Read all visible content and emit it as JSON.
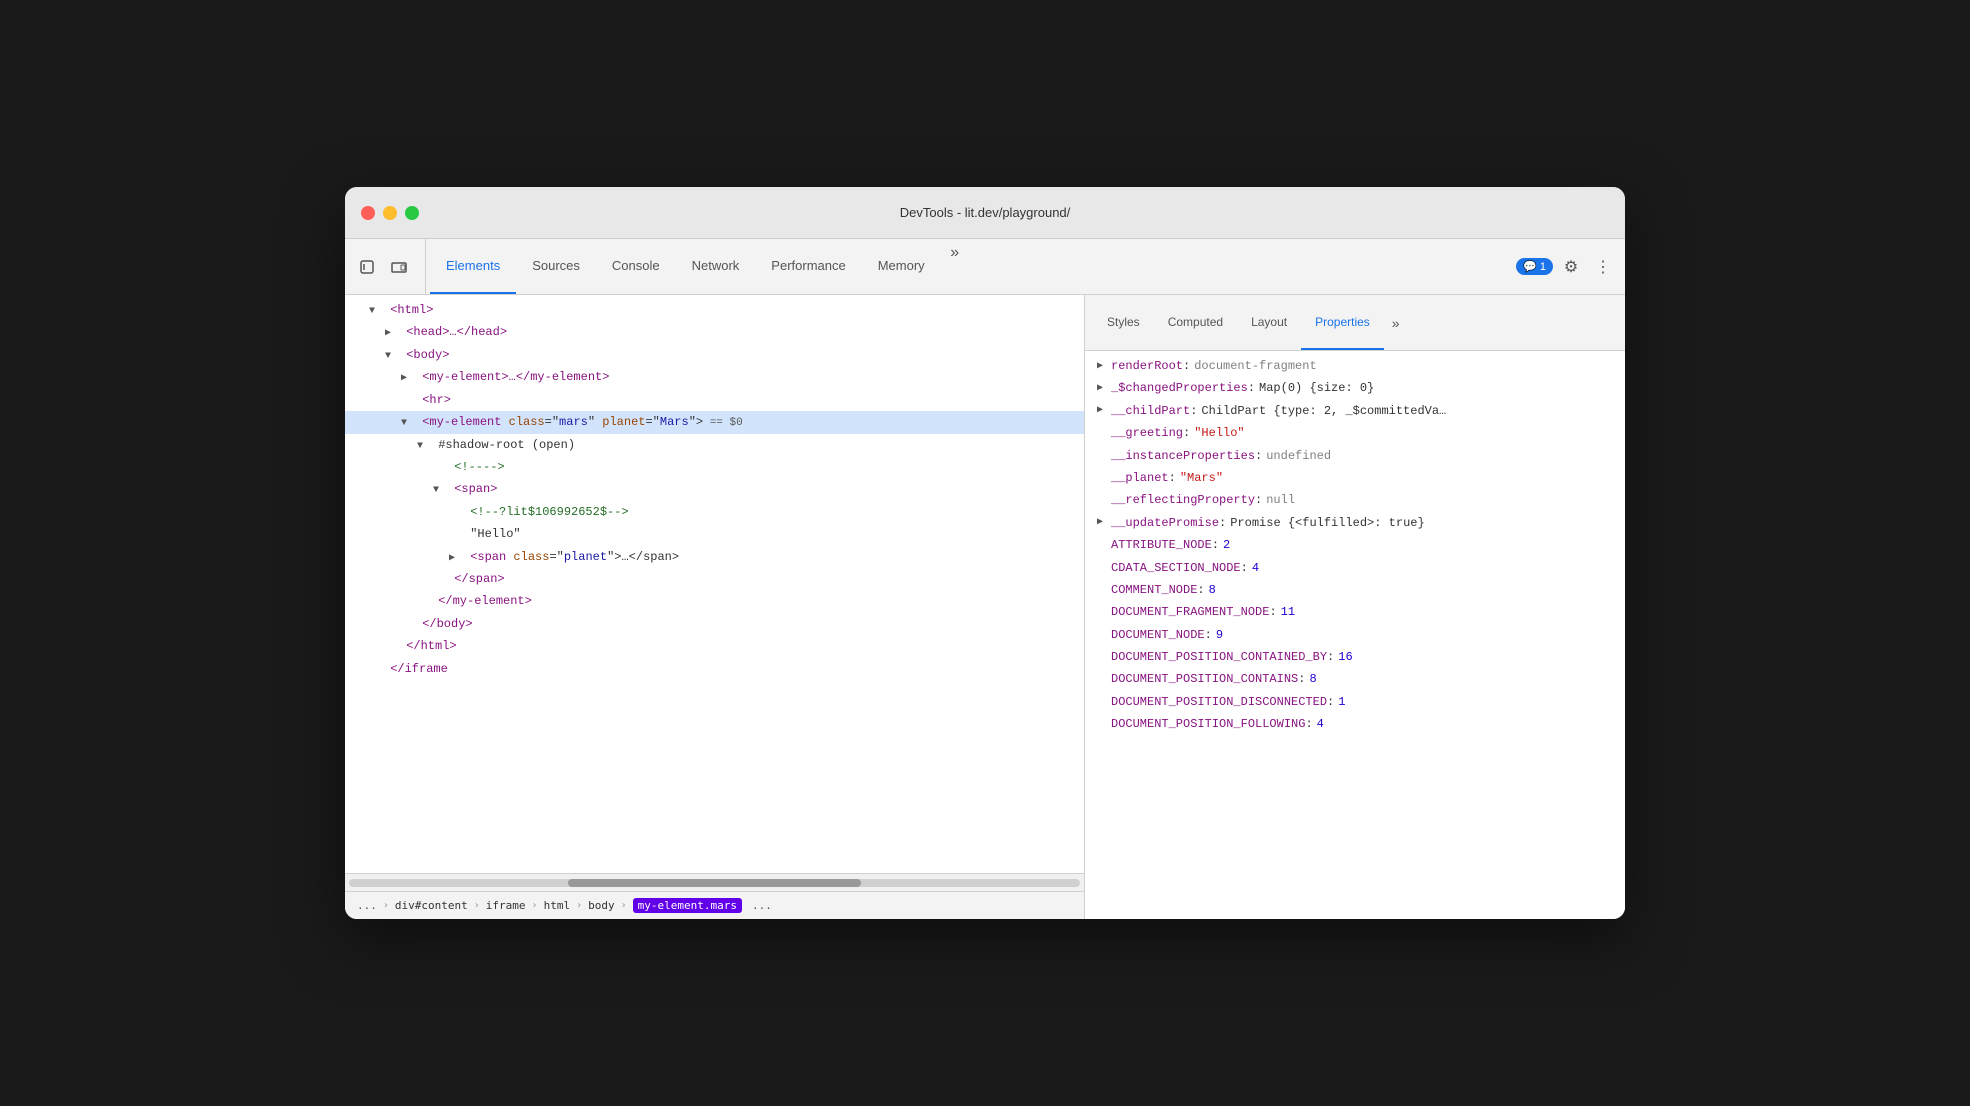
{
  "window": {
    "title": "DevTools - lit.dev/playground/"
  },
  "tabs": {
    "main": [
      {
        "label": "Elements",
        "active": true
      },
      {
        "label": "Sources"
      },
      {
        "label": "Console"
      },
      {
        "label": "Network"
      },
      {
        "label": "Performance"
      },
      {
        "label": "Memory"
      }
    ],
    "panel": [
      {
        "label": "Styles"
      },
      {
        "label": "Computed"
      },
      {
        "label": "Layout"
      },
      {
        "label": "Properties",
        "active": true
      }
    ],
    "chat_badge": "💬 1"
  },
  "dom": {
    "lines": [
      {
        "indent": 1,
        "html": "▼ <html>",
        "type": "tag"
      },
      {
        "indent": 2,
        "html": "▶ <head>…</head>",
        "type": "tag"
      },
      {
        "indent": 2,
        "html": "▼ <body>",
        "type": "tag"
      },
      {
        "indent": 3,
        "html": "▶ <my-element>…</my-element>",
        "type": "tag"
      },
      {
        "indent": 4,
        "html": "<hr>",
        "type": "tag"
      },
      {
        "indent": 4,
        "html": "▼ <my-element class=\"mars\" planet=\"Mars\">  == $0",
        "type": "selected"
      },
      {
        "indent": 5,
        "html": "▼ #shadow-root (open)",
        "type": "shadow"
      },
      {
        "indent": 6,
        "html": "<!---->",
        "type": "comment"
      },
      {
        "indent": 6,
        "html": "▼ <span>",
        "type": "tag"
      },
      {
        "indent": 7,
        "html": "<!--?lit$106992652$-->",
        "type": "comment"
      },
      {
        "indent": 7,
        "html": "\"Hello\"",
        "type": "text"
      },
      {
        "indent": 7,
        "html": "▶ <span class=\"planet\">…</span>",
        "type": "tag"
      },
      {
        "indent": 6,
        "html": "</span>",
        "type": "tag"
      },
      {
        "indent": 5,
        "html": "</my-element>",
        "type": "tag"
      },
      {
        "indent": 4,
        "html": "</body>",
        "type": "tag"
      },
      {
        "indent": 3,
        "html": "</html>",
        "type": "tag"
      },
      {
        "indent": 2,
        "html": "</iframe>",
        "type": "tag-partial"
      }
    ]
  },
  "breadcrumb": {
    "items": [
      "...",
      "div#content",
      "iframe",
      "html",
      "body"
    ],
    "active": "my-element.mars"
  },
  "properties": [
    {
      "key": "renderRoot",
      "colon": ": ",
      "value": "document-fragment",
      "type": "keyword",
      "expandable": true
    },
    {
      "key": "_$changedProperties",
      "colon": ": ",
      "value": "Map(0) {size: 0}",
      "type": "object",
      "expandable": true
    },
    {
      "key": "__childPart",
      "colon": ": ",
      "value": "ChildPart {type: 2, _$committedVa…",
      "type": "object",
      "expandable": true
    },
    {
      "key": "__greeting",
      "colon": ": ",
      "value": "\"Hello\"",
      "type": "string",
      "expandable": false
    },
    {
      "key": "__instanceProperties",
      "colon": ": ",
      "value": "undefined",
      "type": "keyword",
      "expandable": false
    },
    {
      "key": "__planet",
      "colon": ": ",
      "value": "\"Mars\"",
      "type": "string",
      "expandable": false
    },
    {
      "key": "__reflectingProperty",
      "colon": ": ",
      "value": "null",
      "type": "keyword",
      "expandable": false
    },
    {
      "key": "__updatePromise",
      "colon": ": ",
      "value": "Promise {<fulfilled>: true}",
      "type": "object",
      "expandable": true
    },
    {
      "key": "ATTRIBUTE_NODE",
      "colon": ": ",
      "value": "2",
      "type": "number",
      "expandable": false
    },
    {
      "key": "CDATA_SECTION_NODE",
      "colon": ": ",
      "value": "4",
      "type": "number",
      "expandable": false
    },
    {
      "key": "COMMENT_NODE",
      "colon": ": ",
      "value": "8",
      "type": "number",
      "expandable": false
    },
    {
      "key": "DOCUMENT_FRAGMENT_NODE",
      "colon": ": ",
      "value": "11",
      "type": "number",
      "expandable": false
    },
    {
      "key": "DOCUMENT_NODE",
      "colon": ": ",
      "value": "9",
      "type": "number",
      "expandable": false
    },
    {
      "key": "DOCUMENT_POSITION_CONTAINED_BY",
      "colon": ": ",
      "value": "16",
      "type": "number",
      "expandable": false
    },
    {
      "key": "DOCUMENT_POSITION_CONTAINS",
      "colon": ": ",
      "value": "8",
      "type": "number",
      "expandable": false
    },
    {
      "key": "DOCUMENT_POSITION_DISCONNECTED",
      "colon": ": ",
      "value": "1",
      "type": "number",
      "expandable": false
    },
    {
      "key": "DOCUMENT_POSITION_FOLLOWING",
      "colon": ": ",
      "value": "4",
      "type": "number",
      "expandable": false
    }
  ],
  "icons": {
    "cursor": "⬡",
    "responsive": "▭",
    "more": "»",
    "settings": "⚙",
    "three_dots": "⋮"
  }
}
